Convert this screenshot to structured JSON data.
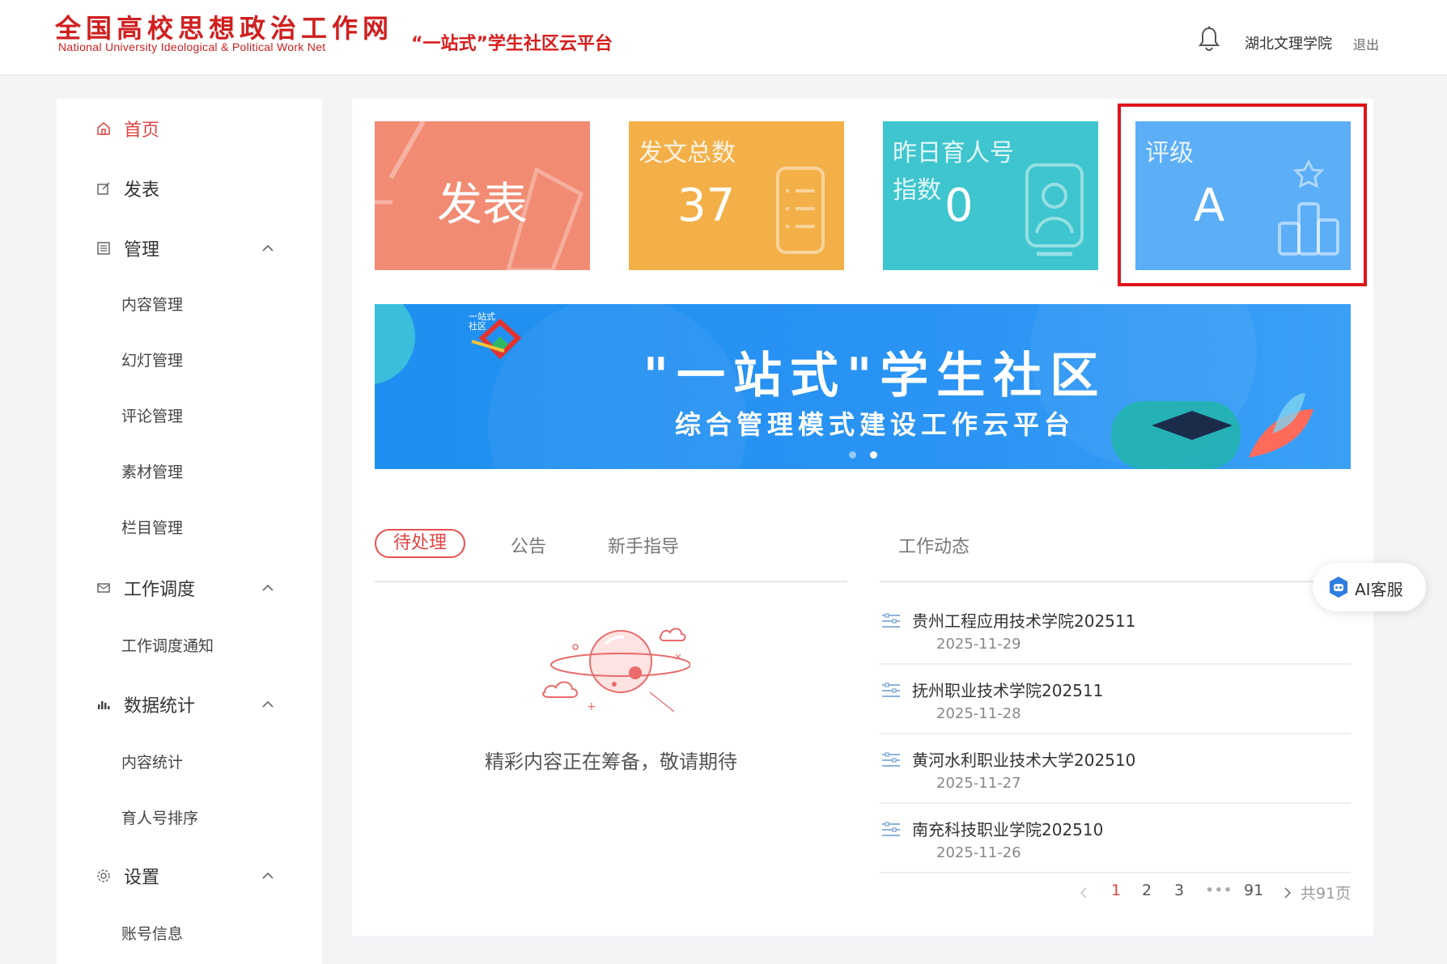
{
  "header": {
    "logo_cn": "全国高校思想政治工作网",
    "logo_en": "National University Ideological & Political Work Net",
    "platform_title": "“一站式”学生社区云平台",
    "user_name": "湖北文理学院",
    "logout_label": "退出"
  },
  "sidebar": {
    "home": "首页",
    "publish": "发表",
    "manage": {
      "label": "管理",
      "items": [
        "内容管理",
        "幻灯管理",
        "评论管理",
        "素材管理",
        "栏目管理"
      ]
    },
    "schedule": {
      "label": "工作调度",
      "items": [
        "工作调度通知"
      ]
    },
    "stats": {
      "label": "数据统计",
      "items": [
        "内容统计",
        "育人号排序"
      ]
    },
    "settings": {
      "label": "设置",
      "items": [
        "账号信息"
      ]
    }
  },
  "cards": {
    "publish": {
      "label": "发表"
    },
    "posts": {
      "title": "发文总数",
      "value": "37"
    },
    "yesterday": {
      "title_line1": "昨日育人号",
      "title_line2": "指数",
      "value": "0"
    },
    "grade": {
      "title": "评级",
      "value": "A"
    }
  },
  "banner": {
    "title": "\"一站式\"学生社区",
    "subtitle": "综合管理模式建设工作云平台",
    "logo_text": "一站式 社区"
  },
  "tabs": [
    "待处理",
    "公告",
    "新手指导"
  ],
  "work_section_title": "工作动态",
  "empty_message": "精彩内容正在筹备，敬请期待",
  "news": [
    {
      "title": "贵州工程应用技术学院202511",
      "date": "2025-11-29"
    },
    {
      "title": "抚州职业技术学院202511",
      "date": "2025-11-28"
    },
    {
      "title": "黄河水利职业技术大学202510",
      "date": "2025-11-27"
    },
    {
      "title": "南充科技职业学院202510",
      "date": "2025-11-26"
    }
  ],
  "pagination": {
    "pages": [
      "1",
      "2",
      "3"
    ],
    "ellipsis": "•••",
    "last": "91",
    "total": "共91页",
    "current": "1"
  },
  "ai_service": "AI客服",
  "colors": {
    "brand_red": "#d01f1f",
    "card_publish": "#f28b73",
    "card_posts": "#f3b048",
    "card_yesterday": "#3ec5ce",
    "card_grade": "#5caef7",
    "highlight": "#e0141b"
  }
}
